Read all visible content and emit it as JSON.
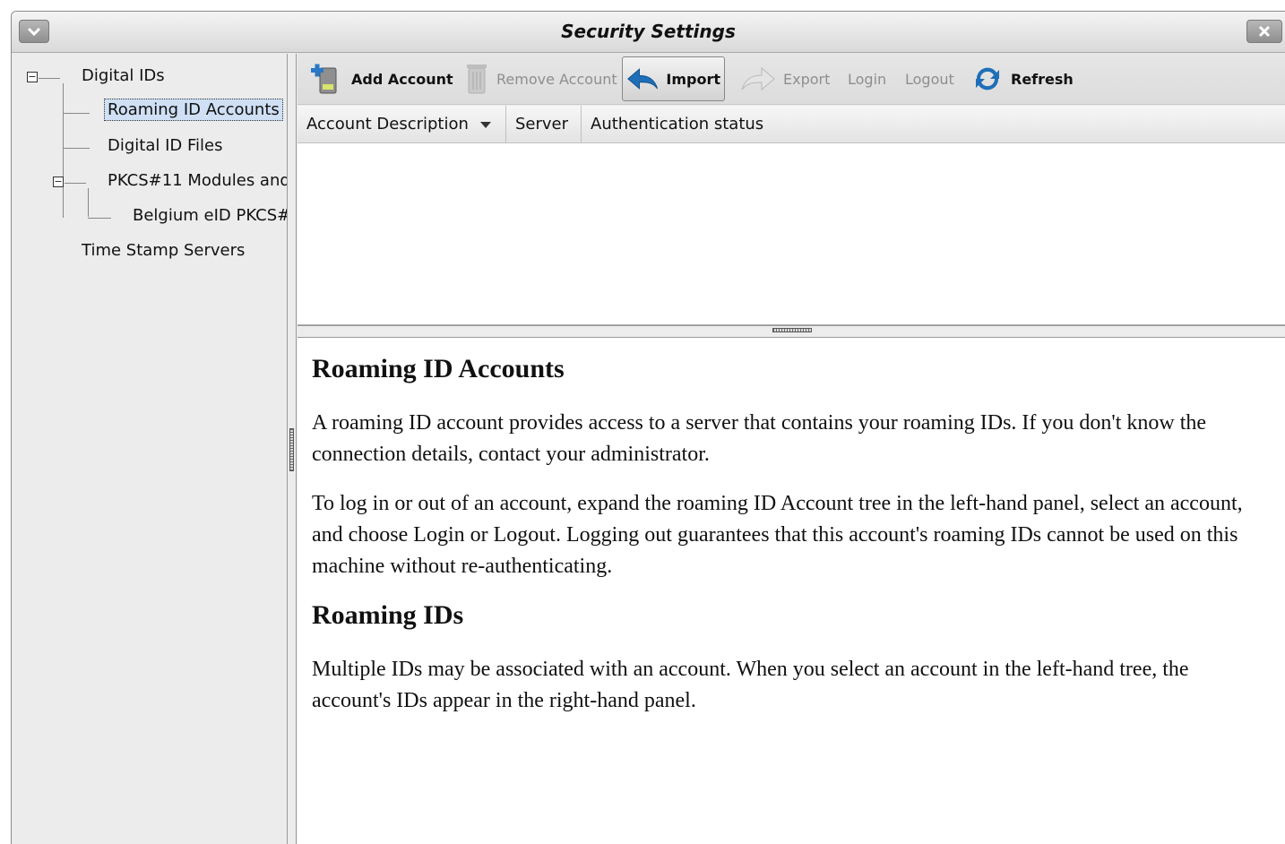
{
  "window": {
    "title": "Security Settings"
  },
  "tree": {
    "digital_ids": "Digital IDs",
    "roaming_accounts": "Roaming ID Accounts",
    "digital_id_files": "Digital ID Files",
    "pkcs_modules": "PKCS#11 Modules and",
    "belgium_eid": "Belgium eID PKCS#",
    "time_stamp": "Time Stamp Servers"
  },
  "toolbar": {
    "add_account": "Add Account",
    "remove_account": "Remove Account",
    "import": "Import",
    "export": "Export",
    "login": "Login",
    "logout": "Logout",
    "refresh": "Refresh"
  },
  "columns": {
    "account_description": "Account Description",
    "server": "Server",
    "auth_status": "Authentication status"
  },
  "help": {
    "heading1": "Roaming ID Accounts",
    "para1": "A roaming ID account provides access to a server that contains your roaming IDs. If you don't know the connection details, contact your administrator.",
    "para2": "To log in or out of an account, expand the roaming ID Account tree in the left-hand panel, select an account, and choose Login or Logout. Logging out guarantees that this account's roaming IDs cannot be used on this machine without re-authenticating.",
    "heading2": "Roaming IDs",
    "para3": "Multiple IDs may be associated with an account. When you select an account in the left-hand tree, the account's IDs appear in the right-hand panel."
  },
  "colors": {
    "selection": "#cfe0f5",
    "accent_blue": "#1e6fb8"
  },
  "icons": [
    "chevron-down-icon",
    "close-icon",
    "add-account-icon",
    "trash-icon",
    "import-arrow-icon",
    "export-arrow-icon",
    "refresh-icon",
    "sort-down-icon"
  ]
}
